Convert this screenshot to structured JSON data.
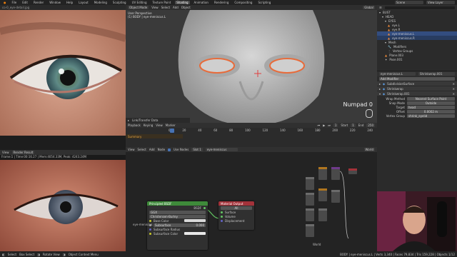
{
  "topbar": {
    "menus": [
      "File",
      "Edit",
      "Render",
      "Window",
      "Help"
    ],
    "tabs": [
      "Layout",
      "Modeling",
      "Sculpting",
      "UV Editing",
      "Texture Paint",
      "Shading",
      "Animation",
      "Rendering",
      "Compositing",
      "Scripting"
    ],
    "active_tab": "Shading",
    "scene_label": "Scene",
    "view_layer_label": "View Layer"
  },
  "image_editor_top": {
    "header_label": "co-0_eye-detail.jpg"
  },
  "viewport": {
    "mode_label": "Object Mode",
    "menus": [
      "View",
      "Select",
      "Add",
      "Object"
    ],
    "orientation_label": "Global",
    "overlay_title": "User Perspective",
    "overlay_object": "(1) BODY | eye-meniscus.L",
    "numpad_label": "Numpad 0",
    "last_op_panel": "Link/Transfer Data"
  },
  "timeline": {
    "menus": [
      "Playback",
      "Keying",
      "View",
      "Marker"
    ],
    "frame_ticks": [
      "0",
      "20",
      "40",
      "60",
      "80",
      "100",
      "120",
      "140",
      "160",
      "180",
      "200",
      "220",
      "240"
    ],
    "current_frame": "1",
    "start_label": "Start",
    "start_value": "1",
    "end_label": "End",
    "end_value": "250",
    "summary_label": "Summary"
  },
  "image_editor_bottom": {
    "view_label": "View",
    "slot_label": "Render Result",
    "info_text": "Frame:1 | Time:00:16.27 | Mem:4054.33M, Peak: 4243.24M"
  },
  "node_editor": {
    "menus": [
      "View",
      "Select",
      "Add",
      "Node"
    ],
    "use_nodes_label": "Use Nodes",
    "slot_label": "Slot 1",
    "material_name": "eye-meniscus",
    "world_label": "World",
    "world_bottom_label": "World",
    "principled": {
      "title": "Principled BSDF",
      "output": "BSDF",
      "distribution": "GGX",
      "subsurface_method": "Christensen-Burley",
      "base_color_label": "Base Color",
      "subsurface_label": "Subsurface",
      "subsurface_value": "0.000",
      "subsurface_radius_label": "Subsurface Radius",
      "subsurface_color_label": "Subsurface Color"
    },
    "material_output": {
      "title": "Material Output",
      "target": "All",
      "inputs": [
        "Surface",
        "Volume",
        "Displacement"
      ]
    },
    "frame_label": "eye-meniscus"
  },
  "outliner": {
    "filter_placeholder": "",
    "items": [
      "BUST",
      "HEAD",
      "EYES",
      "eye.L",
      "eye.R",
      "eye-meniscus.L",
      "eye-meniscus.R",
      "Mesh",
      "Modifiers",
      "Vertex Groups",
      "Plane.003",
      "Pose.001"
    ]
  },
  "properties": {
    "object_name": "eye-meniscus.L",
    "data_name": "Shrinkwrap.001",
    "add_modifier": "Add Modifier",
    "modifiers": [
      {
        "name": "SubdivisionSurface"
      },
      {
        "name": "Shrinkwrap"
      },
      {
        "name": "Shrinkwrap.001"
      }
    ],
    "wrap_method_label": "Wrap Method",
    "wrap_method_value": "Nearest Surface Point",
    "snap_mode_label": "Snap Mode",
    "snap_mode_value": "Outside",
    "target_label": "Target",
    "target_value": "head",
    "offset_label": "Offset",
    "offset_value": "0.0002 m",
    "vertex_group_label": "Vertex Group",
    "vertex_group_value": "shrink_eyelid"
  },
  "statusbar": {
    "select_label": "Select",
    "box_select_label": "Box Select",
    "rotate_label": "Rotate View",
    "context_label": "Object Context Menu",
    "stats": "BODY | eye-meniscus.L | Verts 3,340 | Faces 79,834 | Tris 159,228 | Objects 1/12"
  },
  "webcam": {
    "label": "presenter-webcam"
  },
  "colors": {
    "accent": "#4772b3",
    "header_bg": "#303030",
    "principled_header": "#3e8a3a",
    "output_header": "#a3323a",
    "socket_green": "#63c763",
    "socket_yellow": "#c7c729",
    "socket_grey": "#a1a1a1",
    "playhead": "#4772b3"
  }
}
